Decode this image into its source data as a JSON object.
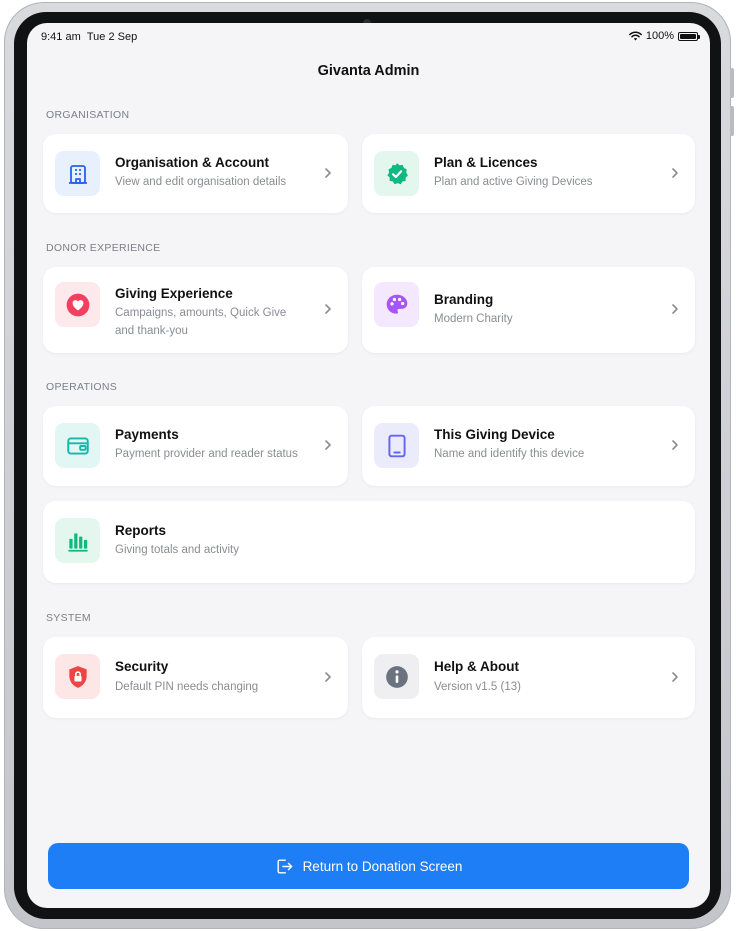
{
  "status_bar": {
    "time": "9:41 am",
    "date": "Tue 2 Sep",
    "battery": "100%",
    "battery_level": 1.0
  },
  "header": {
    "title": "Givanta Admin"
  },
  "sections": {
    "organisation": "ORGANISATION",
    "donor_experience": "DONOR EXPERIENCE",
    "operations": "OPERATIONS",
    "system": "SYSTEM"
  },
  "cards": {
    "organisation_account": {
      "title": "Organisation & Account",
      "subtitle": "View and edit organisation details",
      "icon": "building-icon",
      "color": "#2563eb"
    },
    "plan_licences": {
      "title": "Plan & Licences",
      "subtitle": "Plan and active Giving Devices",
      "icon": "verified-badge-icon",
      "color": "#10b981"
    },
    "giving_experience": {
      "title": "Giving Experience",
      "subtitle_line1": "Campaigns, amounts, Quick Give",
      "subtitle_line2": "and thank-you",
      "icon": "heart-icon",
      "color": "#f43f5e"
    },
    "branding": {
      "title": "Branding",
      "subtitle": "Modern Charity",
      "icon": "palette-icon",
      "color": "#a855f7"
    },
    "payments": {
      "title": "Payments",
      "subtitle": "Payment provider and reader status",
      "icon": "card-icon",
      "color": "#14b8a6"
    },
    "giving_device": {
      "title": "This Giving Device",
      "subtitle": "Name and identify this device",
      "icon": "tablet-icon",
      "color": "#6366f1"
    },
    "reports": {
      "title": "Reports",
      "subtitle": "Giving totals and activity",
      "icon": "bar-chart-icon",
      "color": "#10b981"
    },
    "security": {
      "title": "Security",
      "subtitle": "Default PIN needs changing",
      "icon": "lock-shield-icon",
      "color": "#ef4444"
    },
    "help_about": {
      "title": "Help & About",
      "subtitle": "Version v1.5 (13)",
      "icon": "info-icon",
      "color": "#6b7280"
    }
  },
  "footer": {
    "return_label": "Return to Donation Screen",
    "icon": "exit-icon",
    "color": "#1d7ef5"
  }
}
